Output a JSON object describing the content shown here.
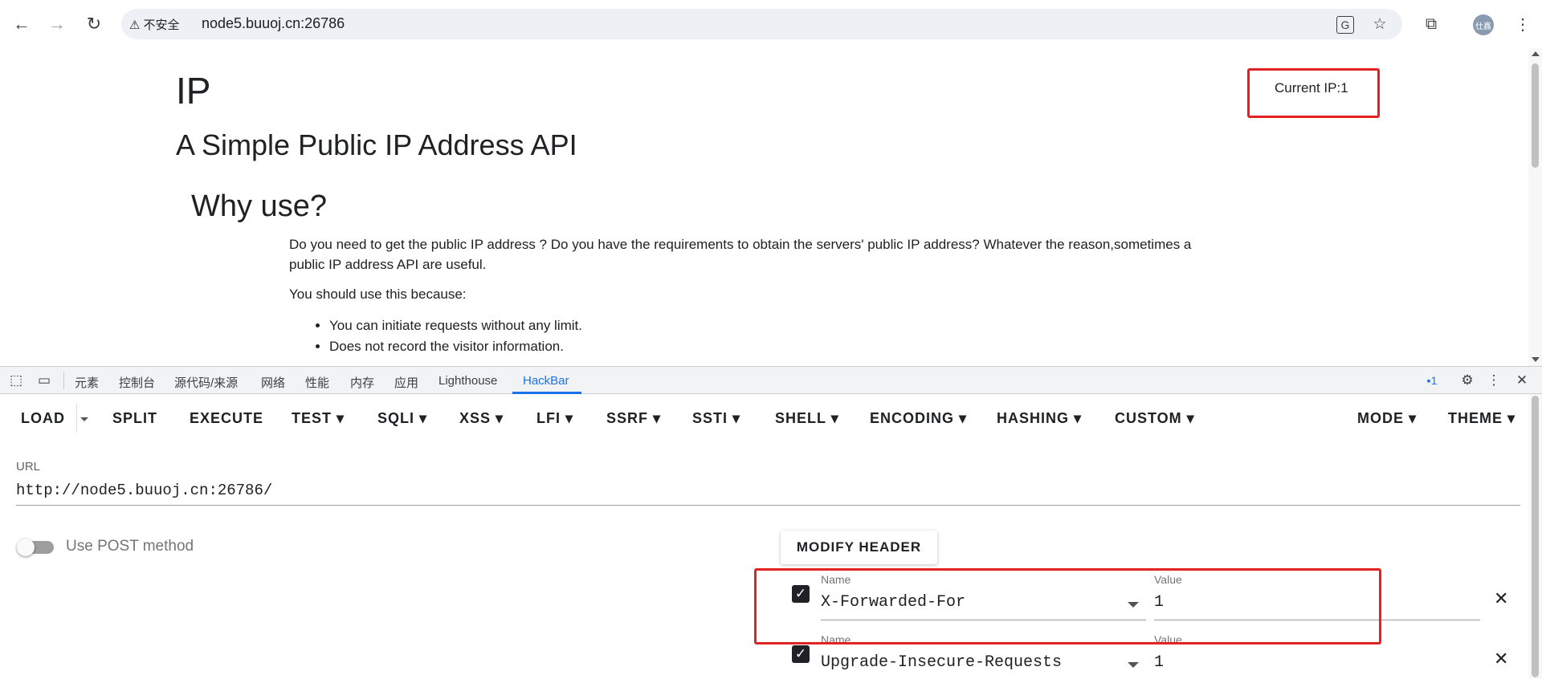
{
  "browser": {
    "security_label": "不安全",
    "url": "node5.buuoj.cn:26786",
    "profile_initials": "仕鑫"
  },
  "page": {
    "title": "IP",
    "subtitle": "A Simple Public IP Address API",
    "why_heading": "Why use?",
    "paragraph1": "Do you need to get the public IP address ? Do you have the requirements to obtain the servers' public IP address? Whatever the reason,sometimes a public IP address API are useful.",
    "paragraph2": "You should use this because:",
    "reasons": [
      "You can initiate requests without any limit.",
      "Does not record the visitor information."
    ],
    "current_ip_label": "Current IP:1",
    "highlight_color": "#e02222"
  },
  "devtools": {
    "tabs": [
      "元素",
      "控制台",
      "源代码/来源",
      "网络",
      "性能",
      "内存",
      "应用",
      "Lighthouse",
      "HackBar"
    ],
    "active_tab": "HackBar",
    "issues_count": "1"
  },
  "hackbar": {
    "buttons": {
      "load": "LOAD",
      "split": "SPLIT",
      "execute": "EXECUTE",
      "test": "TEST",
      "sqli": "SQLI",
      "xss": "XSS",
      "lfi": "LFI",
      "ssrf": "SSRF",
      "ssti": "SSTI",
      "shell": "SHELL",
      "encoding": "ENCODING",
      "hashing": "HASHING",
      "custom": "CUSTOM",
      "mode": "MODE",
      "theme": "THEME"
    },
    "url_label": "URL",
    "url_value": "http://node5.buuoj.cn:26786/",
    "post_method_label": "Use POST method",
    "post_method_enabled": false,
    "modify_header_label": "MODIFY HEADER",
    "headers": [
      {
        "enabled": true,
        "name_label": "Name",
        "name": "X-Forwarded-For",
        "value_label": "Value",
        "value": "1"
      },
      {
        "enabled": true,
        "name_label": "Name",
        "name": "Upgrade-Insecure-Requests",
        "value_label": "Value",
        "value": "1"
      }
    ]
  }
}
